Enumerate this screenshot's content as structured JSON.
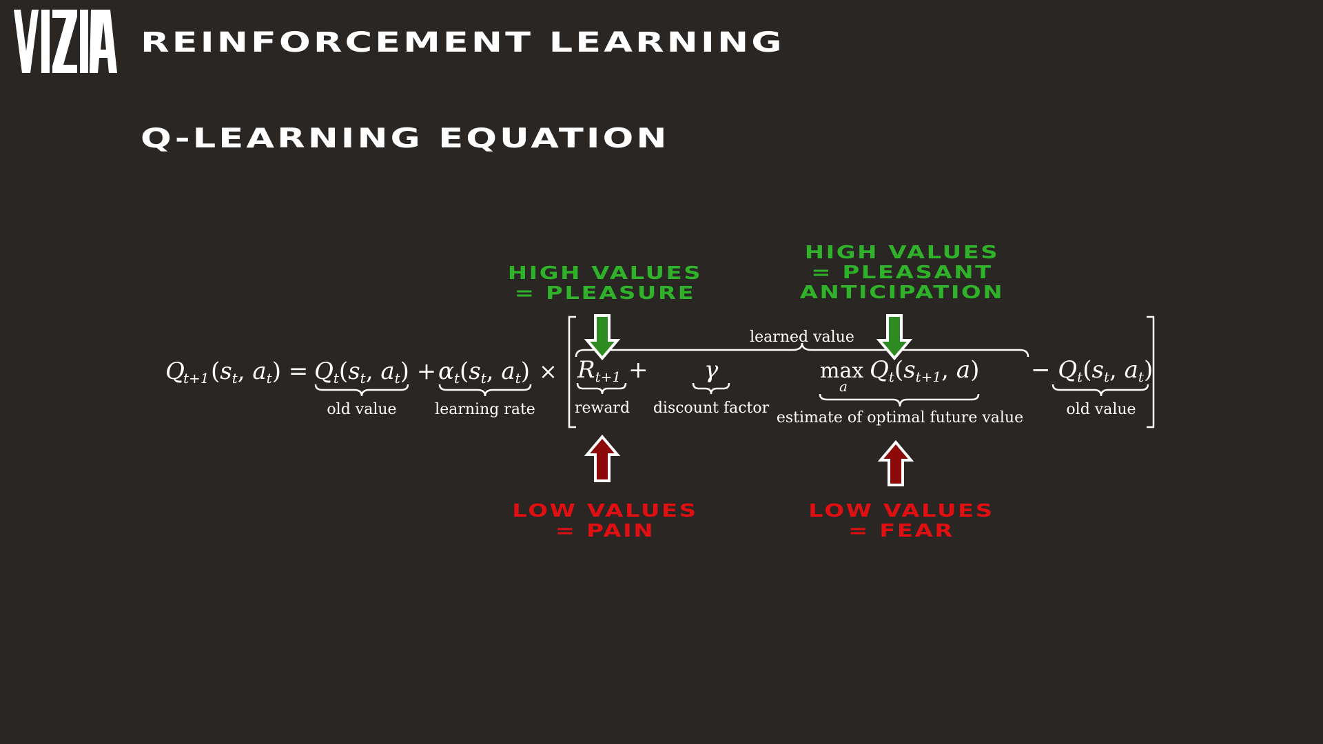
{
  "slide": {
    "logo_text": "VIZIA",
    "title": "REINFORCEMENT LEARNING",
    "subtitle": "Q-LEARNING EQUATION",
    "colors": {
      "background": "#2a2624",
      "positive": "#2fb22a",
      "negative": "#e00f12",
      "arrow_green": "#2e8b22",
      "arrow_red": "#8c0a0a"
    }
  },
  "equation": {
    "lhs": "Q",
    "lhs_sub": "t+1",
    "args": "(s",
    "term_labels": {
      "old_value": "old value",
      "learning_rate": "learning rate",
      "learned_value": "learned value",
      "reward": "reward",
      "discount_factor": "discount factor",
      "estimate": "estimate of optimal future value",
      "old_value_2": "old value"
    },
    "max": "max",
    "max_sub": "a"
  },
  "annotations": {
    "high_pleasure": [
      "HIGH VALUES",
      "= PLEASURE"
    ],
    "high_anticipation": [
      "HIGH VALUES",
      "= PLEASANT",
      "ANTICIPATION"
    ],
    "low_pain": [
      "LOW VALUES",
      "= PAIN"
    ],
    "low_fear": [
      "LOW VALUES",
      "= FEAR"
    ]
  }
}
